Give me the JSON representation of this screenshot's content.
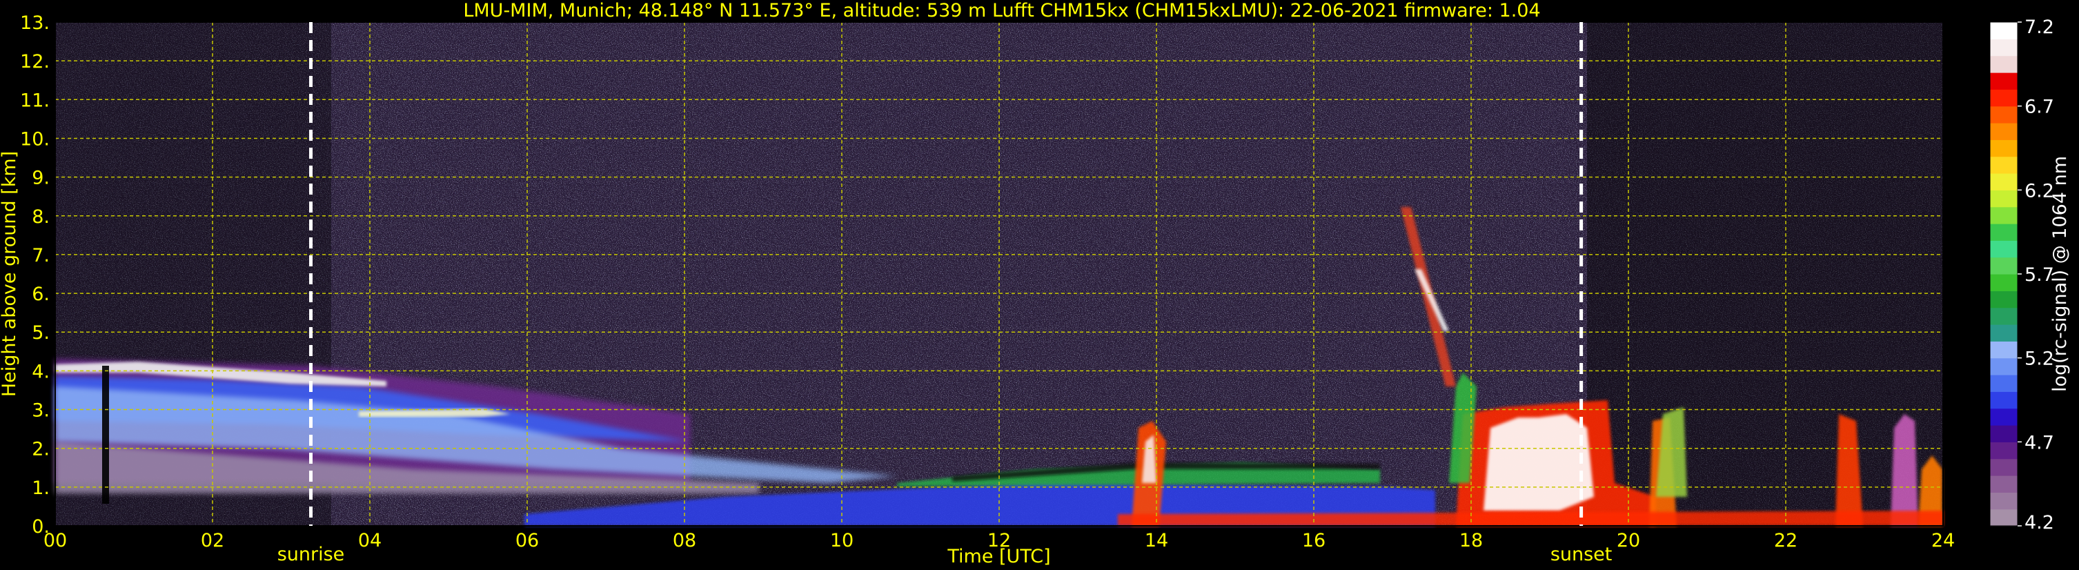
{
  "title": "LMU-MIM, Munich; 48.148° N 11.573° E, altitude: 539 m    Lufft CHM15kx (CHM15kxLMU): 22-06-2021    firmware: 1.04",
  "colors": {
    "background": "#000000",
    "text": "#ffff00",
    "grid": "#c8c800",
    "marker_line": "#ffffff",
    "colorbar_label": "#ffffff"
  },
  "chart_data": {
    "type": "heatmap",
    "xlabel": "Time [UTC]",
    "ylabel": "Height above ground [km]",
    "xlim": [
      0,
      24
    ],
    "ylim": [
      0,
      13
    ],
    "grid": true,
    "x_ticks": [
      {
        "value": 0,
        "label": "00"
      },
      {
        "value": 2,
        "label": "02"
      },
      {
        "value": 4,
        "label": "04"
      },
      {
        "value": 6,
        "label": "06"
      },
      {
        "value": 8,
        "label": "08"
      },
      {
        "value": 10,
        "label": "10"
      },
      {
        "value": 12,
        "label": "12"
      },
      {
        "value": 14,
        "label": "14"
      },
      {
        "value": 16,
        "label": "16"
      },
      {
        "value": 18,
        "label": "18"
      },
      {
        "value": 20,
        "label": "20"
      },
      {
        "value": 22,
        "label": "22"
      },
      {
        "value": 24,
        "label": "24"
      }
    ],
    "y_ticks": [
      {
        "value": 0,
        "label": "0."
      },
      {
        "value": 1,
        "label": "1."
      },
      {
        "value": 2,
        "label": "2."
      },
      {
        "value": 3,
        "label": "3."
      },
      {
        "value": 4,
        "label": "4."
      },
      {
        "value": 5,
        "label": "5."
      },
      {
        "value": 6,
        "label": "6."
      },
      {
        "value": 7,
        "label": "7."
      },
      {
        "value": 8,
        "label": "8."
      },
      {
        "value": 9,
        "label": "9."
      },
      {
        "value": 10,
        "label": "10."
      },
      {
        "value": 11,
        "label": "11."
      },
      {
        "value": 12,
        "label": "12."
      },
      {
        "value": 13,
        "label": "13."
      }
    ],
    "markers": [
      {
        "time": 3.25,
        "label": "sunrise"
      },
      {
        "time": 19.4,
        "label": "sunset"
      }
    ],
    "colorbar": {
      "label": "log(rc-signal) @ 1064 nm",
      "range": [
        4.2,
        7.2
      ],
      "ticks": [
        {
          "value": 4.2,
          "label": "4.2"
        },
        {
          "value": 4.7,
          "label": "4.7"
        },
        {
          "value": 5.2,
          "label": "5.2"
        },
        {
          "value": 5.7,
          "label": "5.7"
        },
        {
          "value": 6.2,
          "label": "6.2"
        },
        {
          "value": 6.7,
          "label": "6.7"
        },
        {
          "value": 7.2,
          "label": "7.2"
        }
      ],
      "colors": [
        "#a690a8",
        "#9a7aa0",
        "#8d5f97",
        "#7a3f8d",
        "#61208a",
        "#400a90",
        "#2a10c8",
        "#2f40e8",
        "#4a6ef0",
        "#6f94f4",
        "#98b6f8",
        "#2a9a8a",
        "#26a060",
        "#20a035",
        "#39c22e",
        "#5ad45a",
        "#3fdc8a",
        "#39c84c",
        "#86e23a",
        "#c8f032",
        "#f0f034",
        "#ffd820",
        "#ffb000",
        "#ff8a00",
        "#ff5a00",
        "#ff2200",
        "#e80000",
        "#f0d8d8",
        "#f8eeee",
        "#ffffff"
      ]
    }
  }
}
